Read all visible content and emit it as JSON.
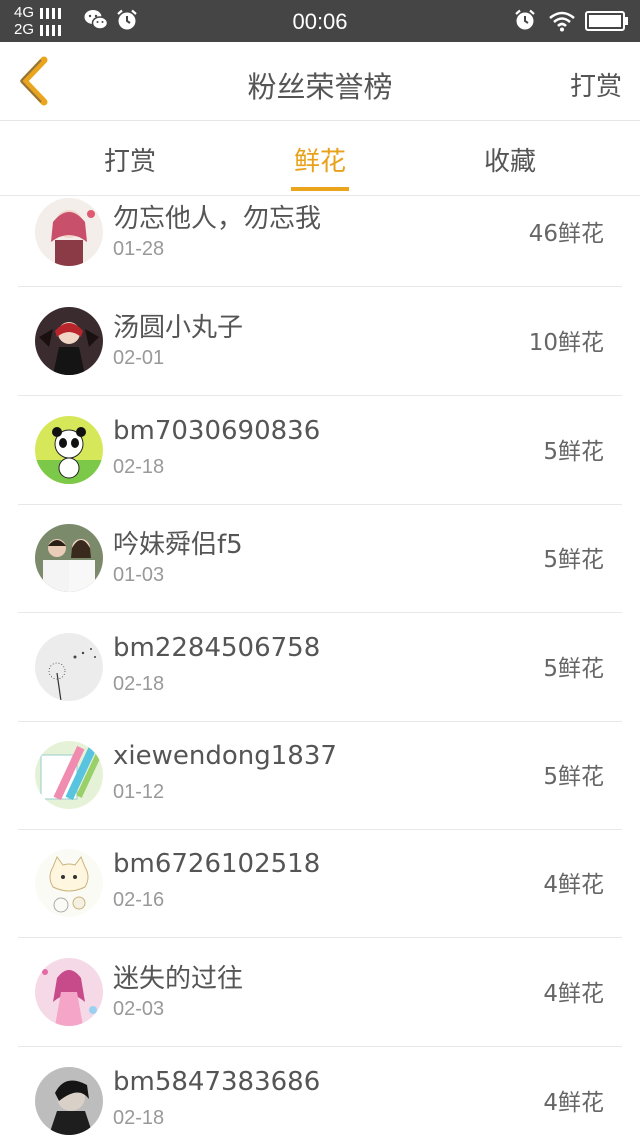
{
  "status_bar": {
    "network_top": "4G",
    "network_bottom": "2G",
    "time": "00:06",
    "icons": [
      "wechat-icon",
      "alarm-icon",
      "wifi-icon",
      "battery-icon"
    ]
  },
  "header": {
    "title": "粉丝荣誉榜",
    "right_link": "打赏",
    "back_icon": "chevron-left-icon"
  },
  "tabs": [
    {
      "label": "打赏",
      "active": false
    },
    {
      "label": "鲜花",
      "active": true
    },
    {
      "label": "收藏",
      "active": false
    }
  ],
  "list": [
    {
      "name": "勿忘他人，勿忘我",
      "date": "01-28",
      "count": "46鲜花"
    },
    {
      "name": "汤圆小丸子",
      "date": "02-01",
      "count": "10鲜花"
    },
    {
      "name": "bm7030690836",
      "date": "02-18",
      "count": "5鲜花"
    },
    {
      "name": "吟妹舜侣f5",
      "date": "01-03",
      "count": "5鲜花"
    },
    {
      "name": "bm2284506758",
      "date": "02-18",
      "count": "5鲜花"
    },
    {
      "name": "xiewendong1837",
      "date": "01-12",
      "count": "5鲜花"
    },
    {
      "name": "bm6726102518",
      "date": "02-16",
      "count": "4鲜花"
    },
    {
      "name": "迷失的过往",
      "date": "02-03",
      "count": "4鲜花"
    },
    {
      "name": "bm5847383686",
      "date": "02-18",
      "count": "4鲜花"
    }
  ],
  "colors": {
    "accent": "#eba51c",
    "status_bar": "#454545",
    "text": "#555555",
    "subtext": "#999999"
  }
}
